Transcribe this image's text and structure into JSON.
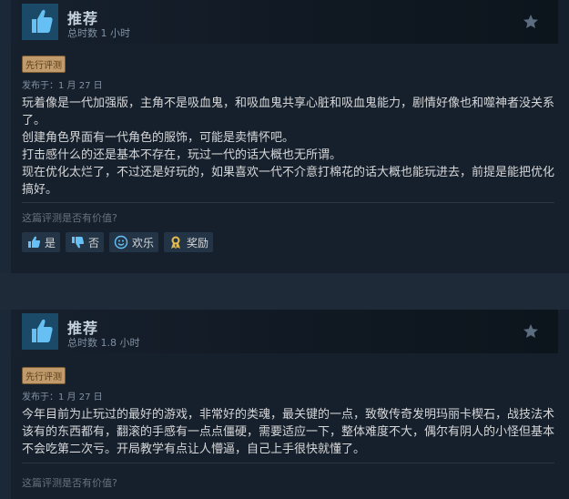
{
  "reviews": [
    {
      "verdict": "推荐",
      "hours": "总时数 1 小时",
      "tag": "先行评测",
      "posted": "发布于：1 月 27 日",
      "body": [
        "玩着像是一代加强版，主角不是吸血鬼，和吸血鬼共享心脏和吸血鬼能力，剧情好像也和噬神者没关系了。",
        "创建角色界面有一代角色的服饰，可能是卖情怀吧。",
        "打击感什么的还是基本不存在，玩过一代的话大概也无所谓。",
        "现在优化太烂了，不过还是好玩的，如果喜欢一代不介意打棉花的话大概也能玩进去，前提是能把优化搞好。"
      ],
      "helpful_question": "这篇评测是否有价值?",
      "buttons": {
        "yes": "是",
        "no": "否",
        "funny": "欢乐",
        "award": "奖励"
      }
    },
    {
      "verdict": "推荐",
      "hours": "总时数 1.8 小时",
      "tag": "先行评测",
      "posted": "发布于：1 月 27 日",
      "body": [
        "今年目前为止玩过的最好的游戏，非常好的类魂，最关键的一点，致敬传奇发明玛丽卡楔石，战技法术该有的东西都有，翻滚的手感有一点点僵硬，需要适应一下，整体难度不大，偶尔有阴人的小怪但基本不会吃第二次亏。开局教学有点让人懵逼，自己上手很快就懂了。"
      ],
      "helpful_question": "这篇评测是否有价值?"
    }
  ],
  "colors": {
    "background": "#1b2838",
    "card": "#16202d",
    "tag": "#c19b6c",
    "thumb_box": "#1b4a69"
  },
  "icons": {
    "thumb": "thumbs-up-icon",
    "award": "star-icon",
    "vote_yes": "thumbs-up-icon",
    "vote_no": "thumbs-down-icon",
    "vote_funny": "smiley-icon",
    "vote_award": "award-ribbon-icon"
  }
}
